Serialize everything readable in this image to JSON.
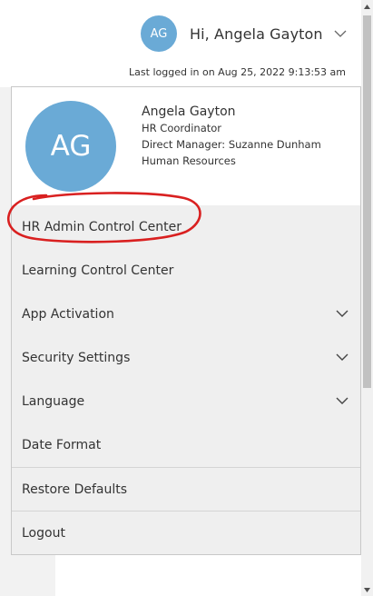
{
  "header": {
    "avatar_initials": "AG",
    "greeting": "Hi, Angela Gayton",
    "chevron_icon": "chevron-down-icon",
    "last_logged_in": "Last logged in on Aug 25, 2022 9:13:53 am"
  },
  "profile": {
    "avatar_initials": "AG",
    "name": "Angela Gayton",
    "title": "HR Coordinator",
    "manager": "Direct Manager: Suzanne Dunham",
    "department": "Human Resources"
  },
  "menu": {
    "items": [
      {
        "label": "HR Admin Control Center",
        "expandable": false
      },
      {
        "label": "Learning Control Center",
        "expandable": false
      },
      {
        "label": "App Activation",
        "expandable": true
      },
      {
        "label": "Security Settings",
        "expandable": true
      },
      {
        "label": "Language",
        "expandable": true
      },
      {
        "label": "Date Format",
        "expandable": false
      },
      {
        "label": "Restore Defaults",
        "expandable": false
      },
      {
        "label": "Logout",
        "expandable": false
      }
    ]
  },
  "colors": {
    "avatar": "#6aaad6",
    "panel_bg": "#efefef",
    "highlight_ring": "#d92020"
  }
}
